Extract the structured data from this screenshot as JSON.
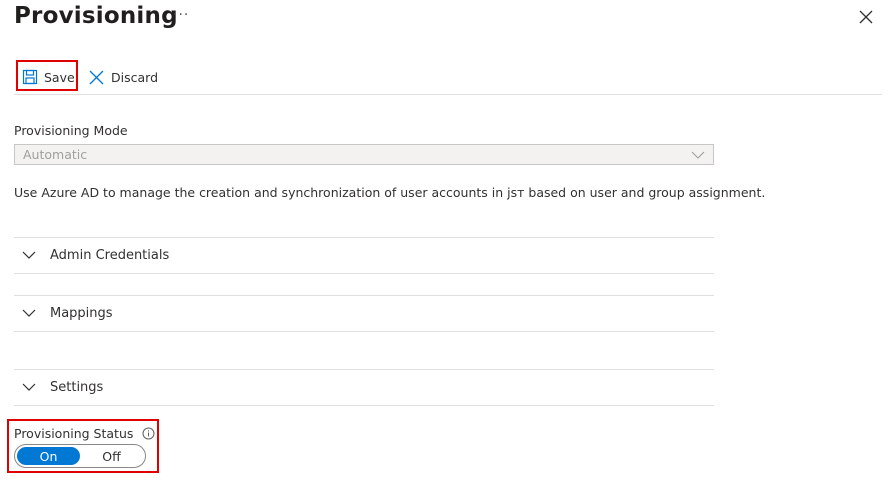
{
  "header": {
    "title": "Provisioning",
    "more_label": "···",
    "close_icon": "close-icon"
  },
  "toolbar": {
    "save_label": "Save",
    "save_icon": "save-icon",
    "discard_label": "Discard",
    "discard_icon": "close-icon"
  },
  "provisioning_mode": {
    "label": "Provisioning Mode",
    "value": "Automatic",
    "disabled": true
  },
  "description": "Use Azure AD to manage the creation and synchronization of user accounts in jsт based on user and group assignment.",
  "sections": [
    {
      "label": "Admin Credentials",
      "expanded": false
    },
    {
      "label": "Mappings",
      "expanded": false
    },
    {
      "label": "Settings",
      "expanded": false
    }
  ],
  "provisioning_status": {
    "label": "Provisioning Status",
    "info_icon": "info-icon",
    "on_label": "On",
    "off_label": "Off",
    "selected": "On"
  },
  "colors": {
    "accent": "#0078d4",
    "highlight": "#e00000",
    "border": "#e1dfdd"
  }
}
